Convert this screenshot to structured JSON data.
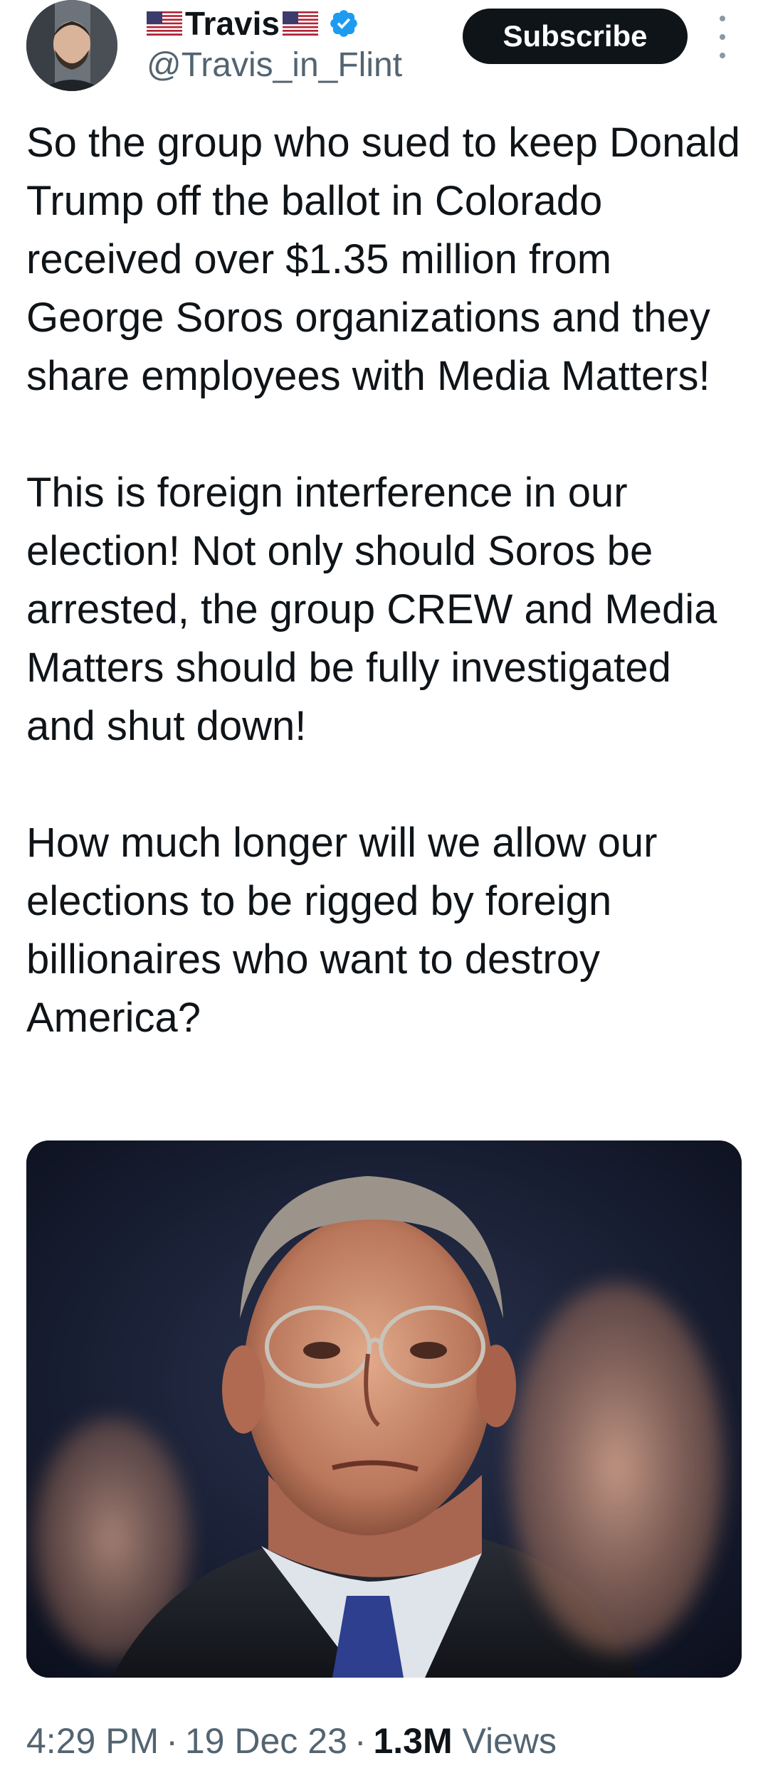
{
  "author": {
    "display_name": "Travis",
    "handle": "@Travis_in_Flint",
    "flag_icon": "us-flag-icon",
    "verified_icon": "verified-badge-icon",
    "verified_color": "#1d9bf0"
  },
  "actions": {
    "subscribe_label": "Subscribe",
    "more_icon": "more-vertical-icon"
  },
  "tweet": {
    "paragraphs": [
      "So the group who sued to keep Donald Trump off the ballot in Colorado received over $1.35 million from George Soros organizations and they share employees with Media Matters!",
      "This is foreign interference in our election!  Not only should Soros be arrested, the group CREW and Media Matters should be fully investigated and shut down!",
      "How much longer will we allow our elections to be rigged by foreign billionaires who want to destroy America?"
    ]
  },
  "meta": {
    "time": "4:29 PM",
    "date": "19 Dec 23",
    "views_count": "1.3M",
    "views_label": "Views",
    "separator": "·"
  },
  "colors": {
    "text_primary": "#0f1419",
    "text_secondary": "#536471",
    "button_bg": "#0f1419",
    "button_text": "#ffffff"
  }
}
